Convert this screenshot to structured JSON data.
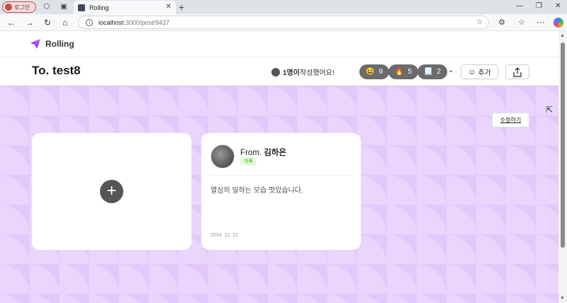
{
  "browser": {
    "profile_label": "로그인",
    "tab_title": "Rolling",
    "url_host": "localhost",
    "url_path": ":3000/post/9437"
  },
  "site": {
    "logo_text": "Rolling"
  },
  "post": {
    "to_title": "To. test8",
    "writer_count": "1명이",
    "writer_suffix": " 작성했어요!",
    "reactions": [
      {
        "emoji": "😆",
        "count": "9"
      },
      {
        "emoji": "🔥",
        "count": "5"
      },
      {
        "emoji": "📃",
        "count": "2"
      }
    ],
    "add_label": "추가",
    "edit_label": "수정하기"
  },
  "cards": {
    "message": {
      "from_prefix": "From. ",
      "from_name": "김하은",
      "relationship": "가족",
      "text": "열심히 일하는 모습 멋있습니다.",
      "date": "2024. 12. 22"
    }
  },
  "colors": {
    "board_bg": "#e3c9fb",
    "logo_accent": "#9935ff",
    "relation_bg": "#e4fbdc",
    "relation_fg": "#2ba600"
  }
}
